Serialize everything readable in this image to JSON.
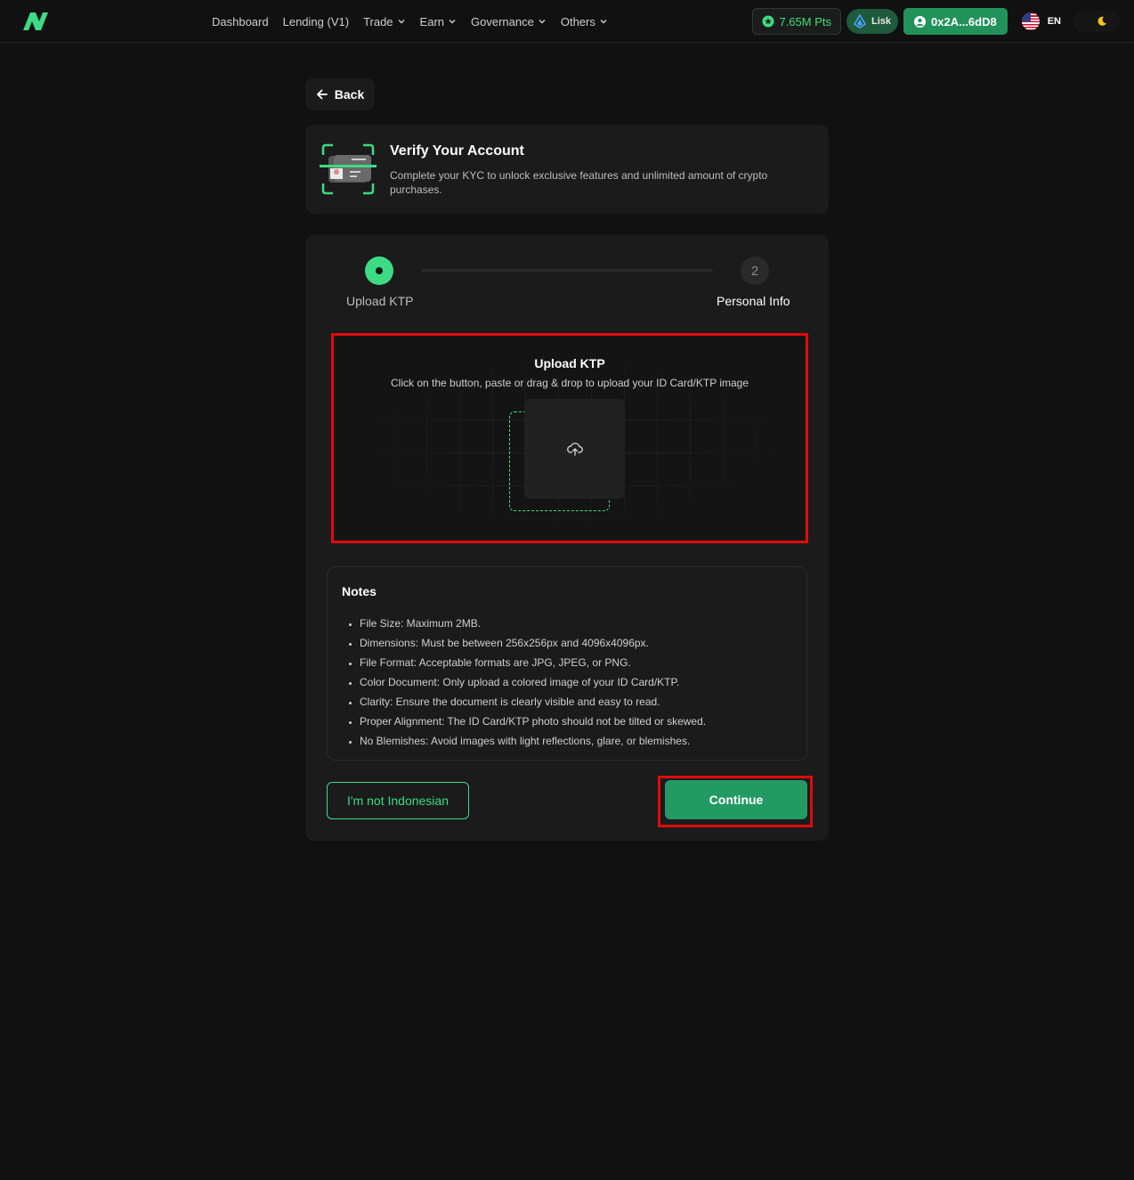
{
  "header": {
    "logo_icon": "brand-logo-icon",
    "nav": [
      {
        "label": "Dashboard",
        "has_chevron": false
      },
      {
        "label": "Lending (V1)",
        "has_chevron": false
      },
      {
        "label": "Trade",
        "has_chevron": true
      },
      {
        "label": "Earn",
        "has_chevron": true
      },
      {
        "label": "Governance",
        "has_chevron": true
      },
      {
        "label": "Others",
        "has_chevron": true
      }
    ],
    "points_label": "7.65M Pts",
    "chain_label": "Lisk",
    "wallet_label": "0x2A...6dD8",
    "language_label": "EN",
    "theme_icon": "moon-icon"
  },
  "back_label": "Back",
  "verify": {
    "title": "Verify Your Account",
    "description": "Complete your KYC to unlock exclusive features and unlimited amount of crypto purchases."
  },
  "steps": [
    {
      "label": "Upload KTP",
      "state": "active"
    },
    {
      "number": "2",
      "label": "Personal Info",
      "state": "pending"
    }
  ],
  "upload": {
    "title": "Upload KTP",
    "subtitle": "Click on the button, paste or drag & drop to upload your ID Card/KTP image",
    "icon": "cloud-upload-icon"
  },
  "notes": {
    "title": "Notes",
    "items": [
      "File Size: Maximum 2MB.",
      "Dimensions: Must be between 256x256px and 4096x4096px.",
      "File Format: Acceptable formats are JPG, JPEG, or PNG.",
      "Color Document: Only upload a colored image of your ID Card/KTP.",
      "Clarity: Ensure the document is clearly visible and easy to read.",
      "Proper Alignment: The ID Card/KTP photo should not be tilted or skewed.",
      "No Blemishes: Avoid images with light reflections, glare, or blemishes."
    ]
  },
  "buttons": {
    "not_indonesian": "I'm not Indonesian",
    "continue": "Continue"
  },
  "colors": {
    "accent": "#3ddc84",
    "primary_button": "#239a64",
    "highlight": "#e10a0a",
    "background": "#111111",
    "card": "#1b1b1b"
  }
}
